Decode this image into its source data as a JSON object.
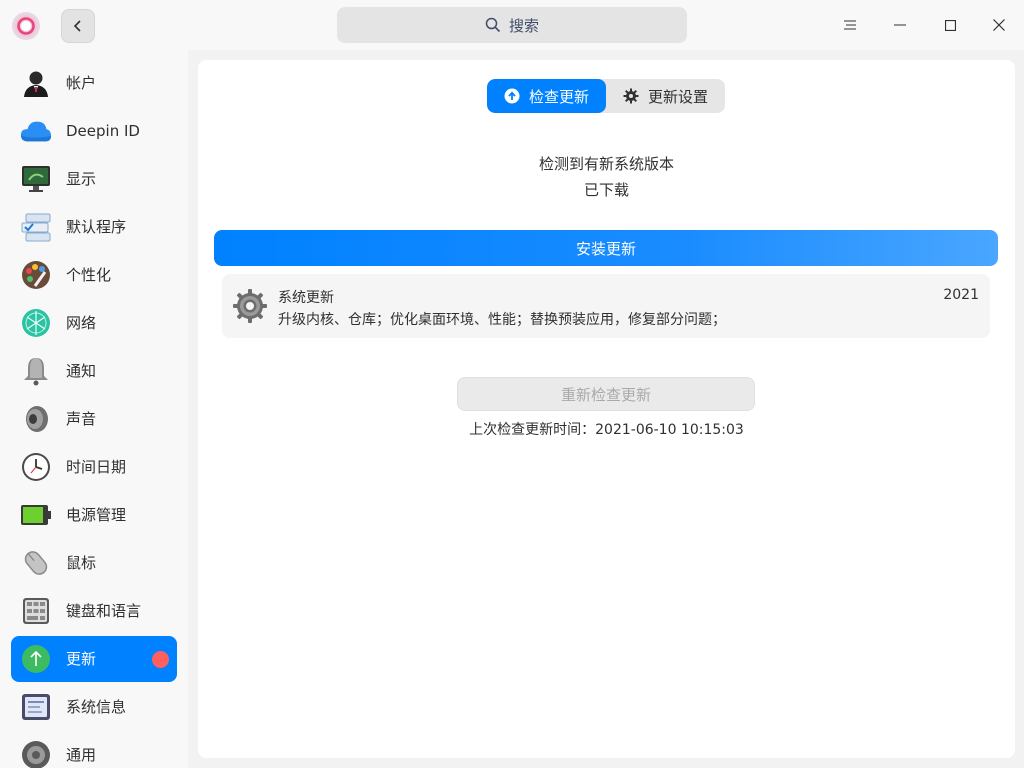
{
  "window": {
    "search_placeholder": "搜索"
  },
  "sidebar": {
    "items": [
      {
        "label": "帐户",
        "icon": "account-icon"
      },
      {
        "label": "Deepin ID",
        "icon": "cloud-icon"
      },
      {
        "label": "显示",
        "icon": "display-icon"
      },
      {
        "label": "默认程序",
        "icon": "default-apps-icon"
      },
      {
        "label": "个性化",
        "icon": "palette-icon"
      },
      {
        "label": "网络",
        "icon": "network-icon"
      },
      {
        "label": "通知",
        "icon": "bell-icon"
      },
      {
        "label": "声音",
        "icon": "speaker-icon"
      },
      {
        "label": "时间日期",
        "icon": "clock-icon"
      },
      {
        "label": "电源管理",
        "icon": "battery-icon"
      },
      {
        "label": "鼠标",
        "icon": "mouse-icon"
      },
      {
        "label": "键盘和语言",
        "icon": "keyboard-icon"
      },
      {
        "label": "更新",
        "icon": "update-arrow-icon",
        "active": true,
        "badge": true
      },
      {
        "label": "系统信息",
        "icon": "system-info-icon"
      },
      {
        "label": "通用",
        "icon": "general-gear-icon"
      }
    ]
  },
  "tabs": {
    "check_update": "检查更新",
    "update_settings": "更新设置"
  },
  "status": {
    "line1": "检测到有新系统版本",
    "line2": "已下载"
  },
  "install_button": "安装更新",
  "update_card": {
    "title": "系统更新",
    "description": "升级内核、仓库；优化桌面环境、性能；替换预装应用，修复部分问题；",
    "year": "2021"
  },
  "recheck_button": "重新检查更新",
  "last_check": "上次检查更新时间：2021-06-10 10:15:03",
  "colors": {
    "accent": "#0081ff",
    "badge": "#ff5f5f"
  }
}
